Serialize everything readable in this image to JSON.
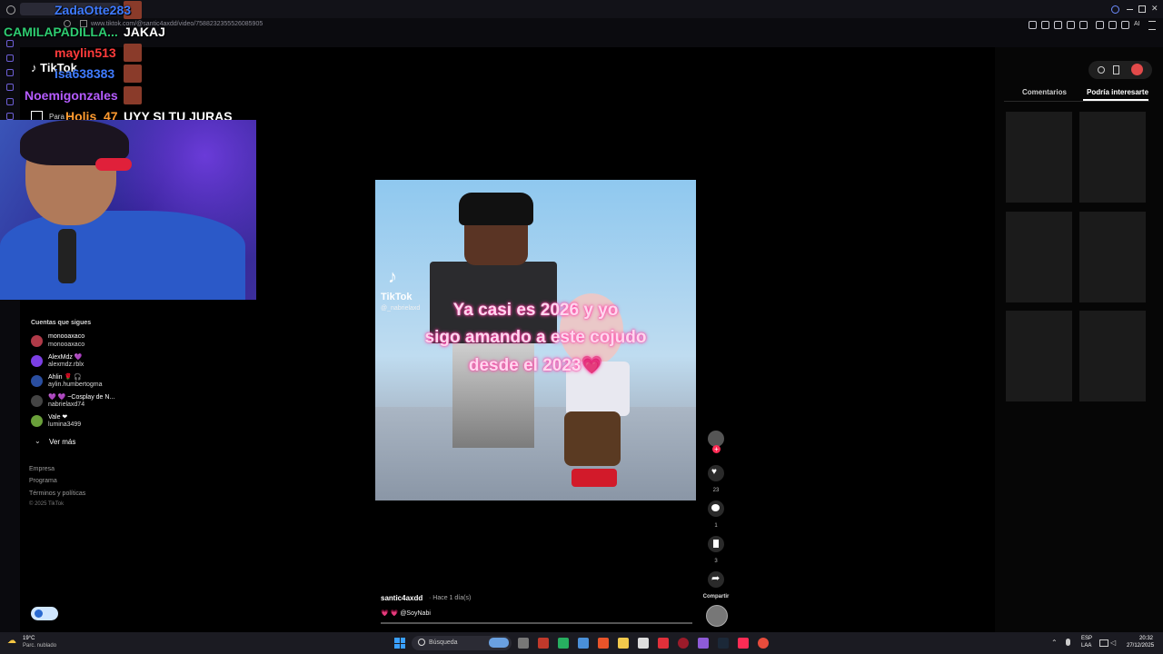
{
  "browser": {
    "url": "www.tiktok.com/@santic4axdd/video/7588232355526085905"
  },
  "chat": [
    {
      "user": "ZadaOtte283",
      "message": "",
      "color": "#3f7bff"
    },
    {
      "user": "CAMILAPADILLA...",
      "message": "JAKAJ",
      "color": "#2ecc71"
    },
    {
      "user": "maylin513",
      "message": "",
      "color": "#ff3b3b"
    },
    {
      "user": "isa638383",
      "message": "",
      "color": "#3f7bff"
    },
    {
      "user": "Noemigonzales",
      "message": "",
      "color": "#b65cff"
    },
    {
      "user": "Holis_47",
      "message": "UYY SI TU JURAS",
      "color": "#ff9b2f"
    }
  ],
  "tiktok": {
    "brand": "TikTok",
    "nav_para_ti": "Para ti",
    "following_title": "Cuentas que sigues",
    "accounts": [
      {
        "name": "monooaxaco",
        "handle": "monooaxaco",
        "color": "#b03a48"
      },
      {
        "name": "AlexMdz 💜",
        "handle": "alexmdz.rblx",
        "color": "#7b3fe4"
      },
      {
        "name": "Ahlin 🌹 🎧",
        "handle": "aylin.humbertogma",
        "color": "#2a4ea0"
      },
      {
        "name": "💜 💜 ~Cosplay de N...",
        "handle": "nabrielaxd74",
        "color": "#444"
      },
      {
        "name": "Vale ❤",
        "handle": "lumina3499",
        "color": "#6aa03a"
      }
    ],
    "ver_mas": "Ver más",
    "footer_links": [
      "Empresa",
      "Programa",
      "Términos y políticas"
    ],
    "copyright": "© 2025 TikTok"
  },
  "video": {
    "caption_lines": [
      "Ya casi es 2026 y yo",
      "sigo amando a este cojudo",
      "desde el 2023💗"
    ],
    "watermark": "TikTok",
    "watermark_handle": "@_nabrielaxd",
    "author": "santic4axdd",
    "posted": "· Hace 1 día(s)",
    "description": "💗 💗 @SoyNabi",
    "likes": "23",
    "comments": "1",
    "saves": "3",
    "share_label": "Compartir"
  },
  "right_panel": {
    "tabs": [
      "Comentarios",
      "Podría interesarte"
    ],
    "active_tab": 1
  },
  "taskbar": {
    "weather_temp": "19°C",
    "weather_desc": "Parc. nublado",
    "search_placeholder": "Búsqueda",
    "lang_top": "ESP",
    "lang_bottom": "LAA",
    "time": "20:32",
    "date": "27/12/2025"
  }
}
